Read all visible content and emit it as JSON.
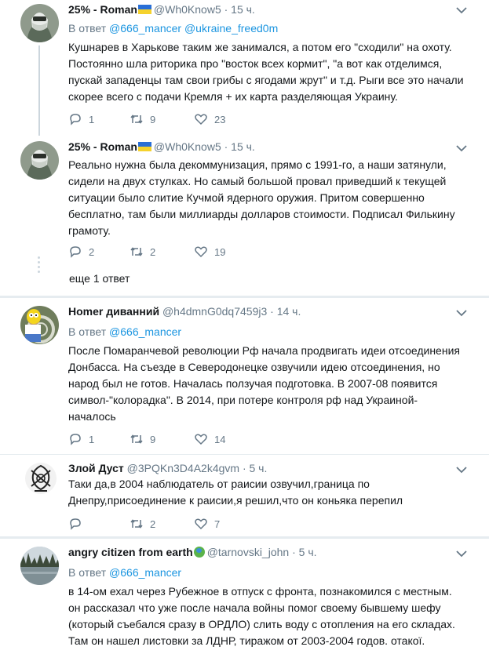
{
  "tweets": [
    {
      "name": "25% - Roman",
      "handle": "@Wh0Know5",
      "time": "· 15 ч.",
      "reply_prefix": "В ответ",
      "reply_to": "@666_mancer @ukraine_freed0m",
      "lines": [
        "Кушнарев в Харькове таким же занимался, а потом его \"сходили\" на охоту.",
        "Постоянно шла риторика про \"восток всех кормит\", \"а вот как отделимся,",
        "пускай западенцы там свои грибы с ягодами жрут\" и т.д. Рыги все это начали",
        "скорее всего с подачи Кремля + их карта разделяющая Украину."
      ],
      "replies": "1",
      "retweets": "9",
      "likes": "23"
    },
    {
      "name": "25% - Roman",
      "handle": "@Wh0Know5",
      "time": "· 15 ч.",
      "lines": [
        "Реально нужна была декоммунизация, прямо с 1991-го, а наши затянули,",
        "сидели на двух стулках. Но самый большой провал приведший к текущей",
        "ситуации было слитие Кучмой ядерного оружия. Притом совершенно",
        "бесплатно, там были миллиарды долларов стоимости. Подписал Филькину",
        "грамоту."
      ],
      "replies": "2",
      "retweets": "2",
      "likes": "19",
      "more_replies": "еще 1 ответ"
    },
    {
      "name": "Homer диванний",
      "handle": "@h4dmnG0dq7459j3",
      "time": "· 14 ч.",
      "reply_prefix": "В ответ",
      "reply_to": "@666_mancer",
      "lines": [
        "После Помаранчевой революции Рф начала продвигать идеи отсоединения",
        "Донбасса. На съезде в Северодонецке озвучили идею отсоединения, но",
        "народ был не готов. Началась ползучая подготовка. В 2007-08 появится",
        "символ-\"колорадка\". В 2014, при потере контроля рф над Украиной-",
        "началось"
      ],
      "replies": "1",
      "retweets": "9",
      "likes": "14"
    },
    {
      "name": "Злой Дуст",
      "handle": "@3PQKn3D4A2k4gvm",
      "time": "· 5 ч.",
      "lines": [
        "Таки да,в 2004 наблюдатель от раисии озвучил,граница по",
        "Днепру,присоединение к раисии,я решил,что он коньяка перепил"
      ],
      "replies": "",
      "retweets": "2",
      "likes": "7"
    },
    {
      "name": "angry citizen from earth",
      "handle": "@tarnovski_john",
      "time": "· 5 ч.",
      "reply_prefix": "В ответ",
      "reply_to": "@666_mancer",
      "lines": [
        "в 14-ом ехал через Рубежное в отпуск с фронта, познакомился с местным.",
        "он рассказал что уже после начала войны помог своему бывшему шефу",
        "(который съебался сразу в ОРДЛО) слить воду с отопления на его складах.",
        "Там он нашел листовки за ЛДНР, тиражом от 2003-2004 годов. отакої."
      ]
    }
  ],
  "colors": {
    "link": "#1b95e0",
    "muted": "#657786",
    "text": "#14171a",
    "divider": "#e6ecf0"
  },
  "icons": [
    "reply-icon",
    "retweet-icon",
    "like-icon",
    "chevron-down-icon",
    "ukraine-flag-icon",
    "globe-icon"
  ]
}
